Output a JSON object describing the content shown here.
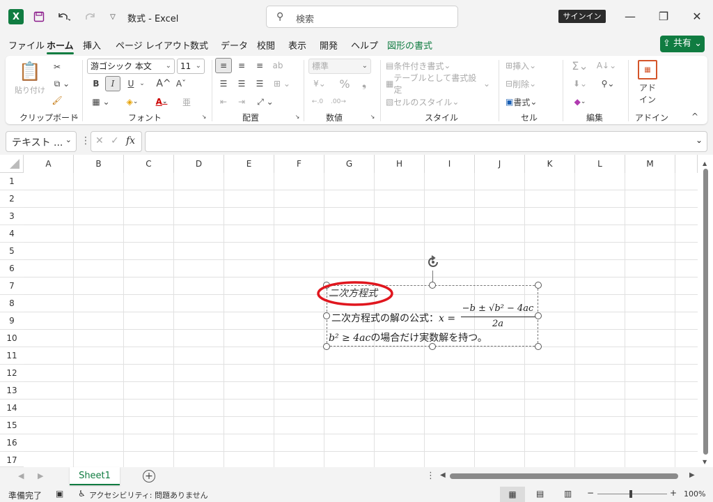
{
  "title": "数式 - Excel",
  "search": {
    "placeholder": "検索"
  },
  "signin": "サインイン",
  "menu": [
    "ファイル",
    "ホーム",
    "挿入",
    "ページ レイアウト",
    "数式",
    "データ",
    "校閲",
    "表示",
    "開発",
    "ヘルプ",
    "図形の書式"
  ],
  "share": "共有",
  "ribbon": {
    "clipboard": {
      "label": "クリップボード",
      "paste": "貼り付け"
    },
    "font": {
      "label": "フォント",
      "name": "游ゴシック 本文",
      "size": "11",
      "bold": "B",
      "italic": "I",
      "underline": "U",
      "grow": "A",
      "shrink": "A"
    },
    "alignment": {
      "label": "配置"
    },
    "number": {
      "label": "数値",
      "format": "標準"
    },
    "styles": {
      "label": "スタイル",
      "conditional": "条件付き書式",
      "table": "テーブルとして書式設定",
      "cell": "セルのスタイル"
    },
    "cells": {
      "label": "セル",
      "insert": "挿入",
      "delete": "削除",
      "format": "書式"
    },
    "editing": {
      "label": "編集"
    },
    "addins": {
      "label": "アドイン",
      "btn": "アド\nイン"
    }
  },
  "formula_bar": {
    "namebox": "テキスト ...",
    "fx": "fx",
    "value": ""
  },
  "columns": [
    "A",
    "B",
    "C",
    "D",
    "E",
    "F",
    "G",
    "H",
    "I",
    "J",
    "K",
    "L",
    "M"
  ],
  "rows": [
    "1",
    "2",
    "3",
    "4",
    "5",
    "6",
    "7",
    "8",
    "9",
    "10",
    "11",
    "12",
    "13",
    "14",
    "15",
    "16",
    "17"
  ],
  "textbox": {
    "title": "二次方程式",
    "line1_prefix": "二次方程式の解の公式：",
    "line1_var": "x =",
    "numerator": "−b ± √b² − 4ac",
    "denominator": "2a",
    "line2_math": "b² ≥ 4ac",
    "line2_text": "の場合だけ実数解を持つ。"
  },
  "sheet_tab": "Sheet1",
  "status": {
    "ready": "準備完了",
    "accessibility": "アクセシビリティ: 問題ありません",
    "zoom": "100%"
  },
  "colors": {
    "accent": "#107c41",
    "highlight": "#e0161e"
  }
}
